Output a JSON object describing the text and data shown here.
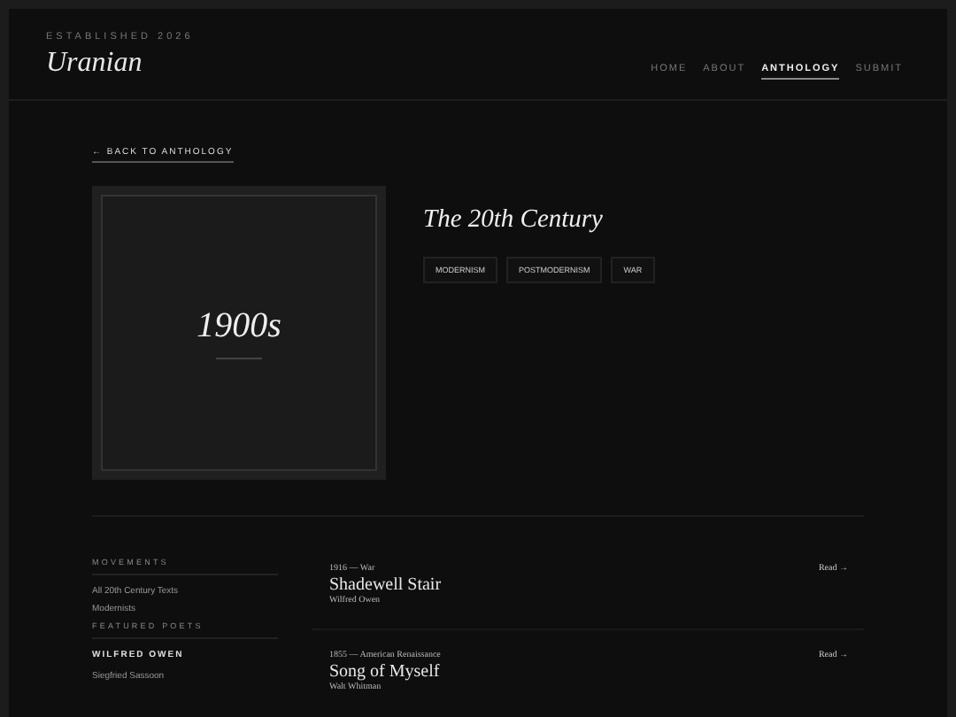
{
  "header": {
    "tagline": "ESTABLISHED 2026",
    "logo": "Uranian"
  },
  "nav": [
    {
      "label": "HOME",
      "selected": false
    },
    {
      "label": "ABOUT",
      "selected": false
    },
    {
      "label": "ANTHOLOGY",
      "selected": true
    },
    {
      "label": "SUBMIT",
      "selected": false
    }
  ],
  "back_link": "← BACK TO ANTHOLOGY",
  "cover": {
    "label": "1900s"
  },
  "title": "The 20th Century",
  "tags": [
    "MODERNISM",
    "POSTMODERNISM",
    "WAR"
  ],
  "sidebar": {
    "movements_heading": "MOVEMENTS",
    "movements": [
      "All 20th Century Texts",
      "Modernists"
    ],
    "poets_heading": "FEATURED POETS",
    "poets": [
      {
        "label": "WILFRED OWEN",
        "selected": true
      },
      {
        "label": "Siegfried Sassoon",
        "selected": false
      }
    ]
  },
  "works": [
    {
      "meta": "1916 — War",
      "title": "Shadewell Stair",
      "author": "Wilfred Owen",
      "link": "Read →"
    },
    {
      "meta": "1855 — American Renaissance",
      "title": "Song of Myself",
      "author": "Walt Whitman",
      "link": "Read →"
    }
  ]
}
